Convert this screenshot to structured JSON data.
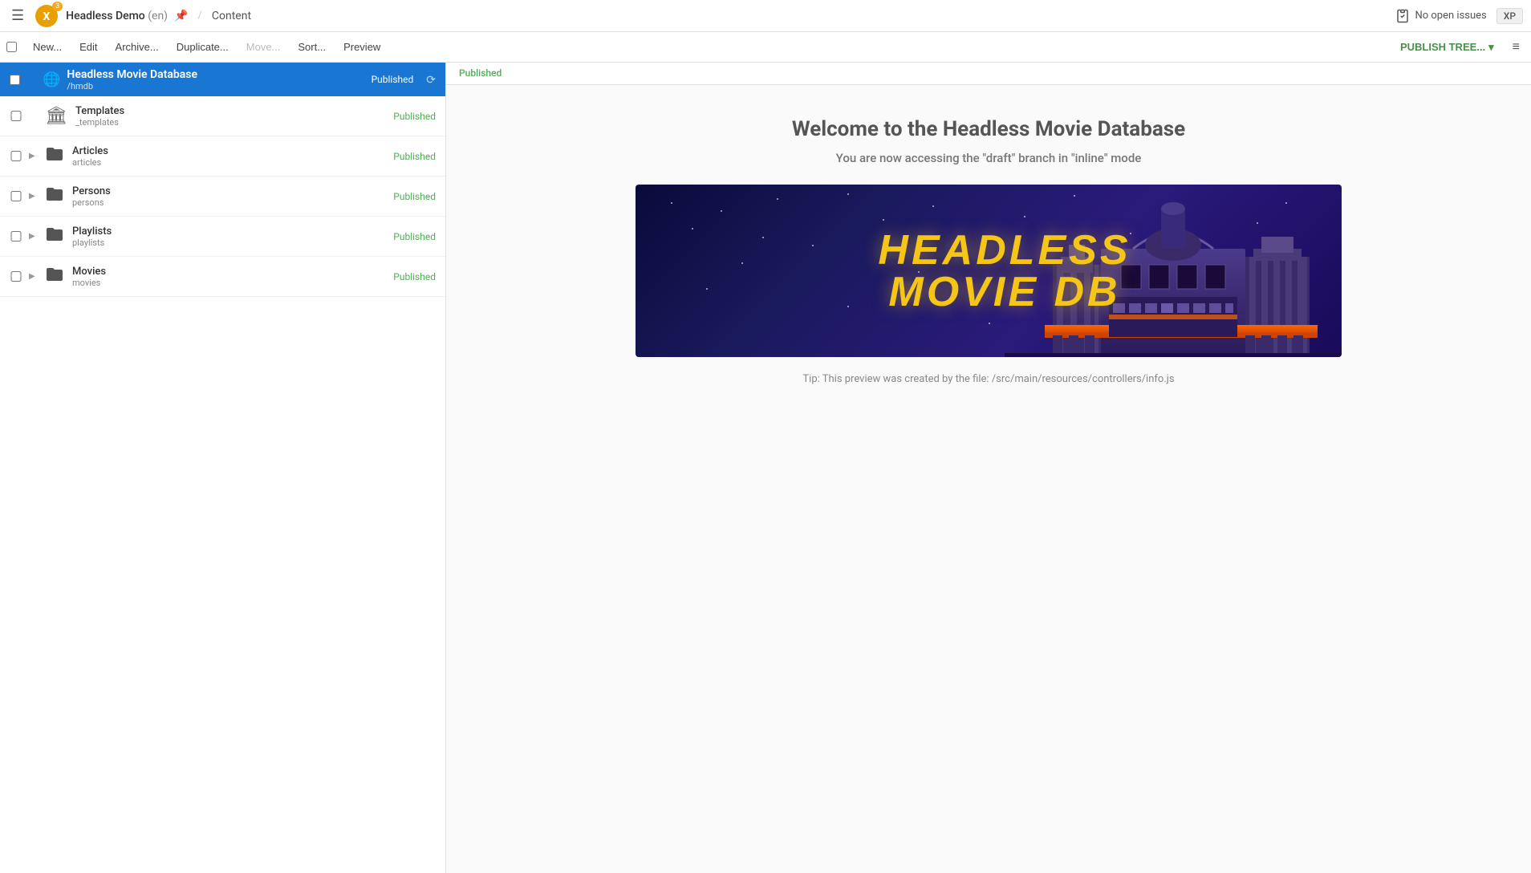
{
  "topNav": {
    "hamburgerLabel": "☰",
    "appBadge": "3",
    "siteName": "Headless Demo",
    "siteNameLang": "(en)",
    "arrowIcon": "→",
    "separator": "/",
    "sectionName": "Content",
    "noIssues": "No open issues",
    "xpLabel": "XP"
  },
  "toolbar": {
    "newLabel": "New...",
    "editLabel": "Edit",
    "archiveLabel": "Archive...",
    "duplicateLabel": "Duplicate...",
    "moveLabel": "Move...",
    "sortLabel": "Sort...",
    "previewLabel": "Preview",
    "publishTreeLabel": "PUBLISH TREE...",
    "chevronDown": "▾",
    "listViewIcon": "≡"
  },
  "sidebar": {
    "root": {
      "title": "Headless Movie Database",
      "sub": "/hmdb",
      "status": "Published"
    },
    "refreshIcon": "⟳",
    "items": [
      {
        "id": "templates",
        "icon": "🏛",
        "iconType": "temple",
        "title": "Templates",
        "sub": "_templates",
        "status": "Published",
        "expandable": false
      },
      {
        "id": "articles",
        "icon": "📁",
        "iconType": "folder",
        "title": "Articles",
        "sub": "articles",
        "status": "Published",
        "expandable": true
      },
      {
        "id": "persons",
        "icon": "📁",
        "iconType": "folder",
        "title": "Persons",
        "sub": "persons",
        "status": "Published",
        "expandable": true
      },
      {
        "id": "playlists",
        "icon": "📁",
        "iconType": "folder",
        "title": "Playlists",
        "sub": "playlists",
        "status": "Published",
        "expandable": true
      },
      {
        "id": "movies",
        "icon": "📁",
        "iconType": "folder",
        "title": "Movies",
        "sub": "movies",
        "status": "Published",
        "expandable": true
      }
    ]
  },
  "content": {
    "statusLabel": "Published",
    "welcomeTitle": "Welcome to the Headless Movie Database",
    "welcomeSubtitle": "You are now accessing the \"draft\" branch in \"inline\" mode",
    "heroBannerLine1": "HEADLESS",
    "heroBannerLine2": "MOVIE DB",
    "tipText": "Tip: This preview was created by the file: /src/main/resources/controllers/info.js"
  }
}
